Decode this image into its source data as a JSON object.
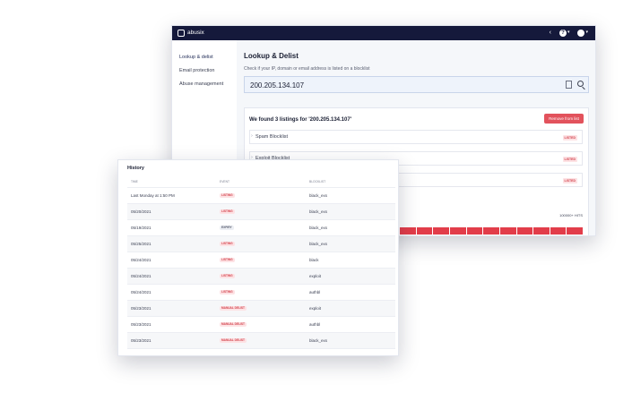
{
  "app": {
    "brand": "abusix",
    "help_caret": "▾",
    "avatar_caret": "▾"
  },
  "sidebar": {
    "items": [
      {
        "label": "Lookup & delist"
      },
      {
        "label": "Email protection"
      },
      {
        "label": "Abuse management"
      }
    ]
  },
  "lookup": {
    "title": "Lookup & Delist",
    "subtitle": "Check if your IP, domain or email address is listed on a blocklist",
    "search_value": "200.205.134.107"
  },
  "results": {
    "found_text": "We found 3 listings for '200.205.134.107'",
    "remove_label": "Remove from list",
    "blocklists": [
      {
        "name": "Spam Blocklist",
        "status": "LISTED"
      },
      {
        "name": "Exploit Blocklist",
        "status": "LISTED"
      },
      {
        "name": "",
        "status": "LISTED"
      }
    ],
    "hits_label": "100000+ HITS",
    "bar_color": "#e23d4a",
    "bar_count": 20
  },
  "history": {
    "title": "History",
    "columns": [
      "TIME",
      "EVENT",
      "BLOCKLIST"
    ],
    "rows": [
      {
        "time": "Last Monday at 1:50 PM",
        "event": "LISTING",
        "type": "listing",
        "blocklist": "black_exs"
      },
      {
        "time": "05/20/2021",
        "event": "LISTING",
        "type": "listing",
        "blocklist": "black_exs"
      },
      {
        "time": "05/19/2021",
        "event": "EXPIRY",
        "type": "expiry",
        "blocklist": "black_exs"
      },
      {
        "time": "05/25/2021",
        "event": "LISTING",
        "type": "listing",
        "blocklist": "black_exs"
      },
      {
        "time": "05/24/2021",
        "event": "LISTING",
        "type": "listing",
        "blocklist": "black"
      },
      {
        "time": "05/24/2021",
        "event": "LISTING",
        "type": "listing",
        "blocklist": "exploit"
      },
      {
        "time": "05/24/2021",
        "event": "LISTING",
        "type": "listing",
        "blocklist": "authbl"
      },
      {
        "time": "05/23/2021",
        "event": "MANUAL DELIST",
        "type": "manual",
        "blocklist": "exploit"
      },
      {
        "time": "05/23/2021",
        "event": "MANUAL DELIST",
        "type": "manual",
        "blocklist": "authbl"
      },
      {
        "time": "05/23/2021",
        "event": "MANUAL DELIST",
        "type": "manual",
        "blocklist": "black_exs"
      }
    ]
  }
}
